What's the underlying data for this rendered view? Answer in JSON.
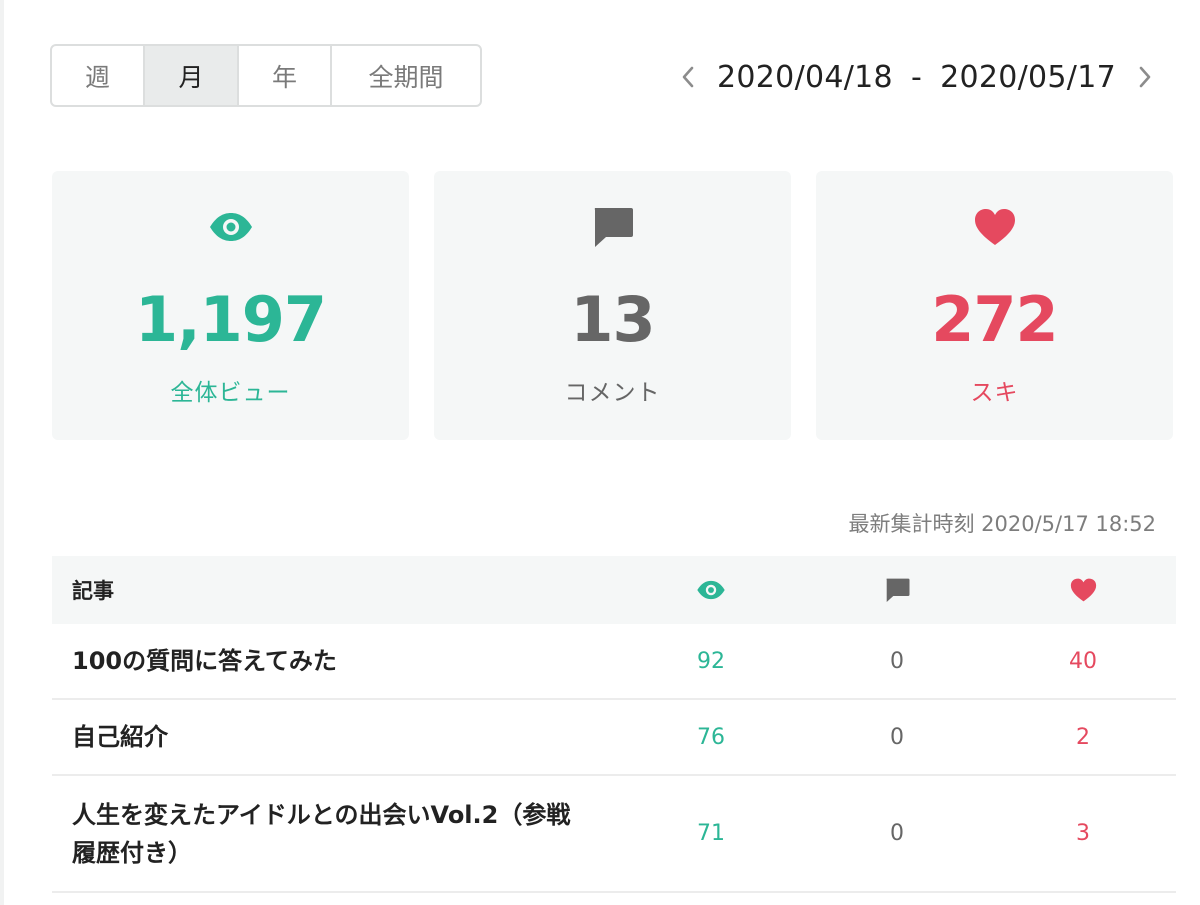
{
  "period": {
    "tabs": [
      {
        "label": "週"
      },
      {
        "label": "月"
      },
      {
        "label": "年"
      },
      {
        "label": "全期間"
      }
    ],
    "active_index": 1
  },
  "date_range": {
    "start": "2020/04/18",
    "separator": "-",
    "end": "2020/05/17"
  },
  "cards": [
    {
      "icon": "eye-icon",
      "value": "1,197",
      "label": "全体ビュー",
      "color": "#2cb696"
    },
    {
      "icon": "comment-icon",
      "value": "13",
      "label": "コメント",
      "color": "#666666"
    },
    {
      "icon": "heart-icon",
      "value": "272",
      "label": "スキ",
      "color": "#e5495f"
    }
  ],
  "updated": "最新集計時刻 2020/5/17 18:52",
  "table": {
    "header": {
      "title": "記事",
      "views_icon": "eye-icon",
      "comments_icon": "comment-icon",
      "likes_icon": "heart-icon"
    },
    "rows": [
      {
        "title": "100の質問に答えてみた",
        "views": "92",
        "comments": "0",
        "likes": "40"
      },
      {
        "title": "自己紹介",
        "views": "76",
        "comments": "0",
        "likes": "2"
      },
      {
        "title": "人生を変えたアイドルとの出会いVol.2（参戦履歴付き）",
        "views": "71",
        "comments": "0",
        "likes": "3"
      }
    ]
  },
  "colors": {
    "accent_green": "#2cb696",
    "accent_pink": "#e5495f",
    "neutral_gray": "#666666"
  }
}
